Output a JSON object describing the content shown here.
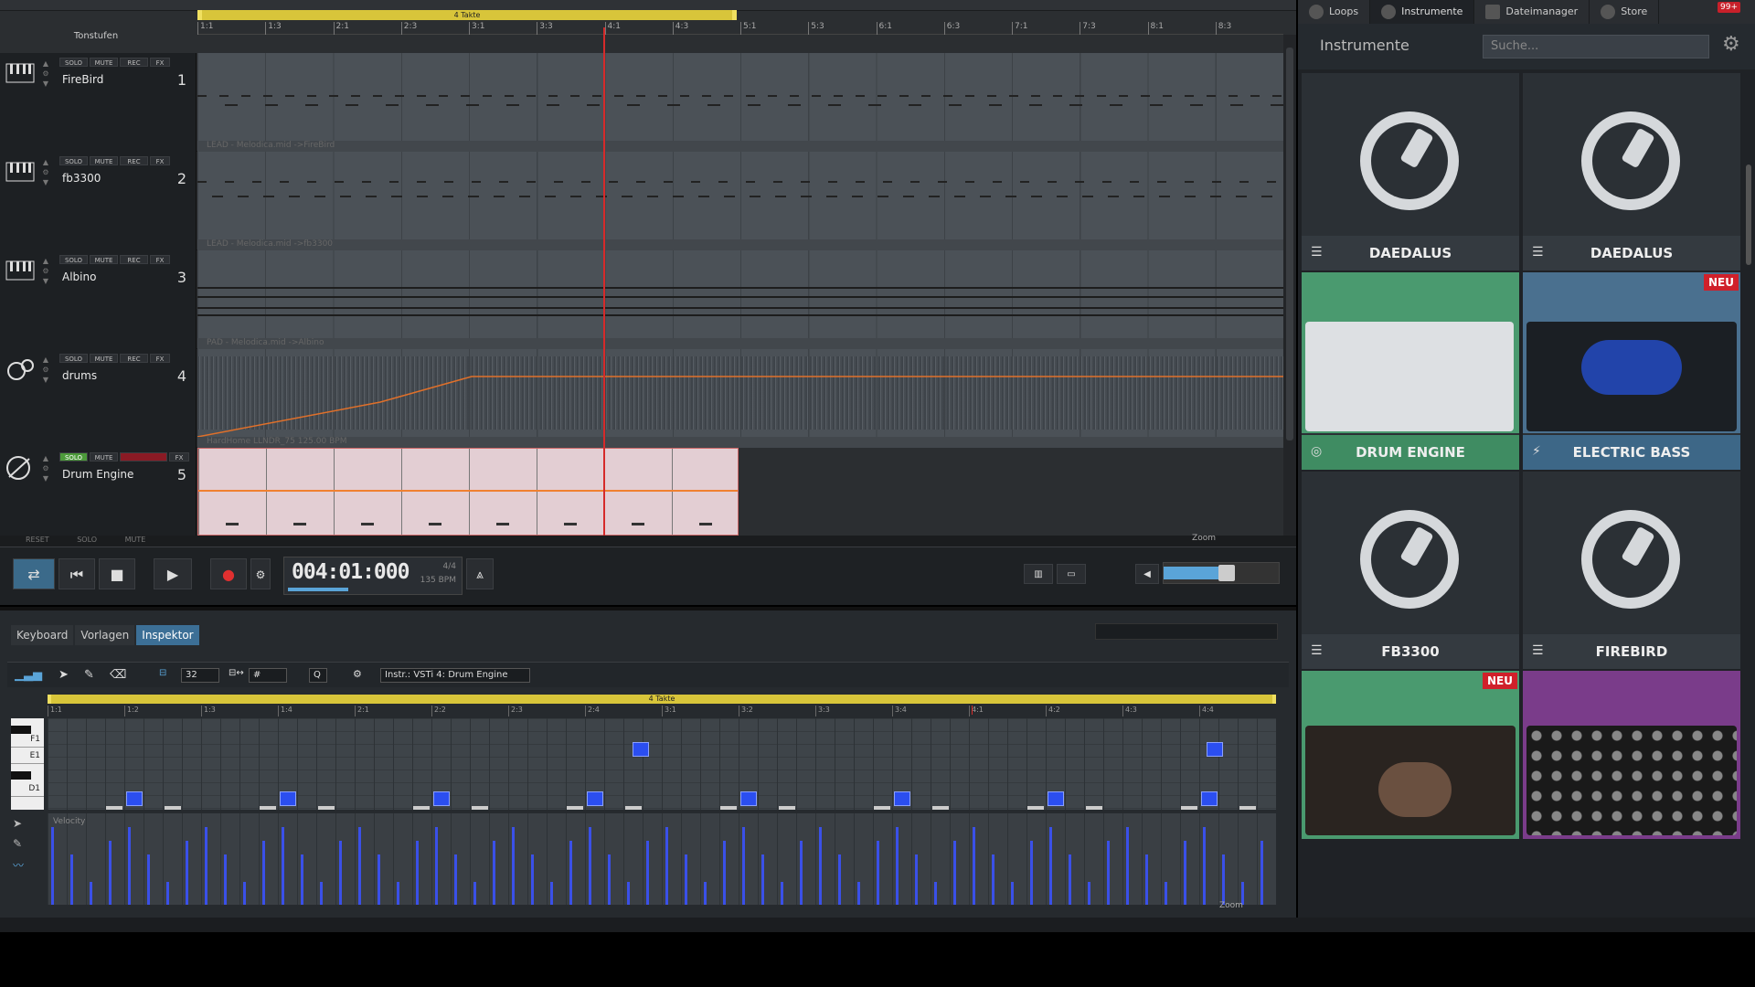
{
  "arranger": {
    "loop_label": "4 Takte",
    "tonstufen": "Tonstufen",
    "ruler": [
      "1:1",
      "1:3",
      "2:1",
      "2:3",
      "3:1",
      "3:3",
      "4:1",
      "4:3",
      "5:1",
      "5:3",
      "6:1",
      "6:3",
      "7:1",
      "7:3",
      "8:1",
      "8:3"
    ],
    "tracks": [
      {
        "name": "FireBird",
        "number": "1",
        "clip": "LEAD - Melodica.mid ->FireBird",
        "buttons": [
          "SOLO",
          "MUTE",
          "REC",
          "FX"
        ]
      },
      {
        "name": "fb3300",
        "number": "2",
        "clip": "LEAD - Melodica.mid ->fb3300",
        "buttons": [
          "SOLO",
          "MUTE",
          "REC",
          "FX"
        ]
      },
      {
        "name": "Albino",
        "number": "3",
        "clip": "PAD - Melodica.mid ->Albino",
        "buttons": [
          "SOLO",
          "MUTE",
          "REC",
          "FX"
        ]
      },
      {
        "name": "drums",
        "number": "4",
        "clip": "HardHome LLNDR_75 125.00 BPM",
        "buttons": [
          "SOLO",
          "MUTE",
          "REC",
          "FX"
        ]
      },
      {
        "name": "Drum Engine",
        "number": "5",
        "clip": "",
        "buttons": [
          "SOLO",
          "MUTE",
          "",
          "FX"
        ]
      }
    ],
    "footer": [
      "RESET",
      "SOLO",
      "MUTE"
    ],
    "zoom_label": "Zoom"
  },
  "transport": {
    "time": "004:01:000",
    "signature": "4/4",
    "bpm": "135 BPM",
    "position_progress": 0.35,
    "volume_level": 0.55
  },
  "editor": {
    "tabs": [
      "Keyboard",
      "Vorlagen",
      "Inspektor"
    ],
    "active_tab": "Inspektor",
    "quantize": "32",
    "grid": "#",
    "q_label": "Q",
    "instrument_select": "Instr.: VSTi 4: Drum Engine",
    "loop_label": "4 Takte",
    "ruler": [
      "1:1",
      "1:2",
      "1:3",
      "1:4",
      "2:1",
      "2:2",
      "2:3",
      "2:4",
      "3:1",
      "3:2",
      "3:3",
      "3:4",
      "4:1",
      "4:2",
      "4:3",
      "4:4"
    ],
    "keys": [
      "F1",
      "E1",
      "D1"
    ],
    "velocity_label": "Velocity",
    "zoom_label": "Zoom"
  },
  "browser": {
    "tabs": [
      "Loops",
      "Instrumente",
      "Dateimanager",
      "Store"
    ],
    "active_tab": "Instrumente",
    "store_badge": "99+",
    "title": "Instrumente",
    "search_placeholder": "Suche...",
    "tiles": [
      {
        "label": "DAEDALUS",
        "style": "ring",
        "badge": ""
      },
      {
        "label": "DAEDALUS",
        "style": "ring",
        "badge": ""
      },
      {
        "label": "DRUM ENGINE",
        "style": "green",
        "badge": ""
      },
      {
        "label": "ELECTRIC BASS",
        "style": "blue",
        "badge": "NEU"
      },
      {
        "label": "FB3300",
        "style": "ring",
        "badge": ""
      },
      {
        "label": "FIREBIRD",
        "style": "ring",
        "badge": ""
      },
      {
        "label": "",
        "style": "green",
        "badge": "NEU"
      },
      {
        "label": "",
        "style": "purple",
        "badge": ""
      }
    ],
    "colors": {
      "green": "#4a9a6f",
      "blue": "#4a708f",
      "purple": "#7a3c8a",
      "badge": "#d0202a"
    }
  }
}
